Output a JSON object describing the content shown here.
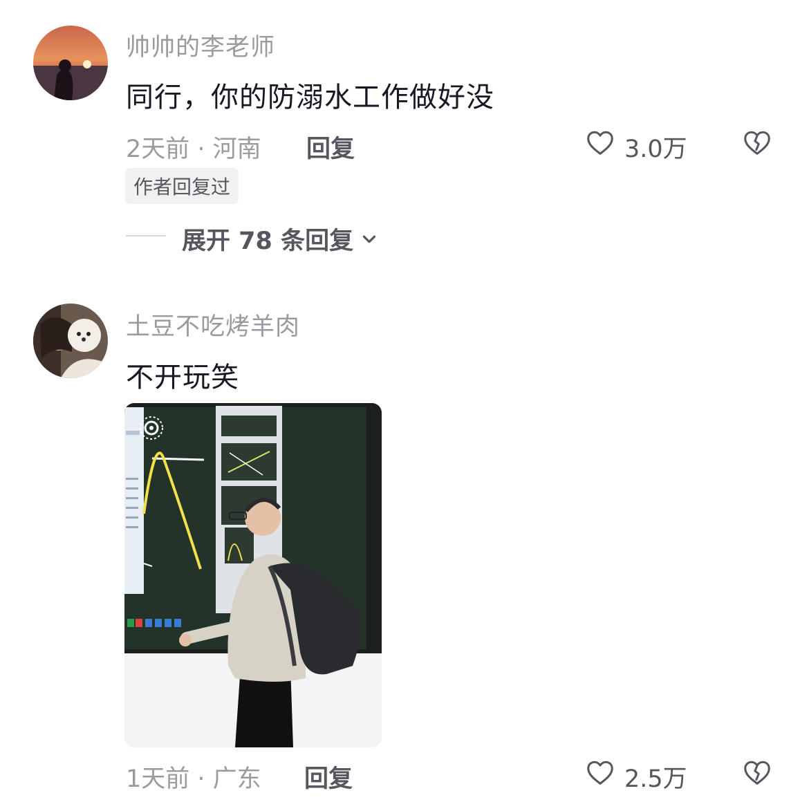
{
  "comments": [
    {
      "username": "帅帅的李老师",
      "text": "同行，你的防溺水工作做好没",
      "meta": "2天前 · 河南",
      "reply_label": "回复",
      "likes": "3.0万",
      "author_badge": "作者回复过",
      "expand_label": "展开 78 条回复"
    },
    {
      "username": "土豆不吃烤羊肉",
      "text": "不开玩笑",
      "meta": "1天前 · 广东",
      "reply_label": "回复",
      "likes": "2.5万"
    }
  ]
}
